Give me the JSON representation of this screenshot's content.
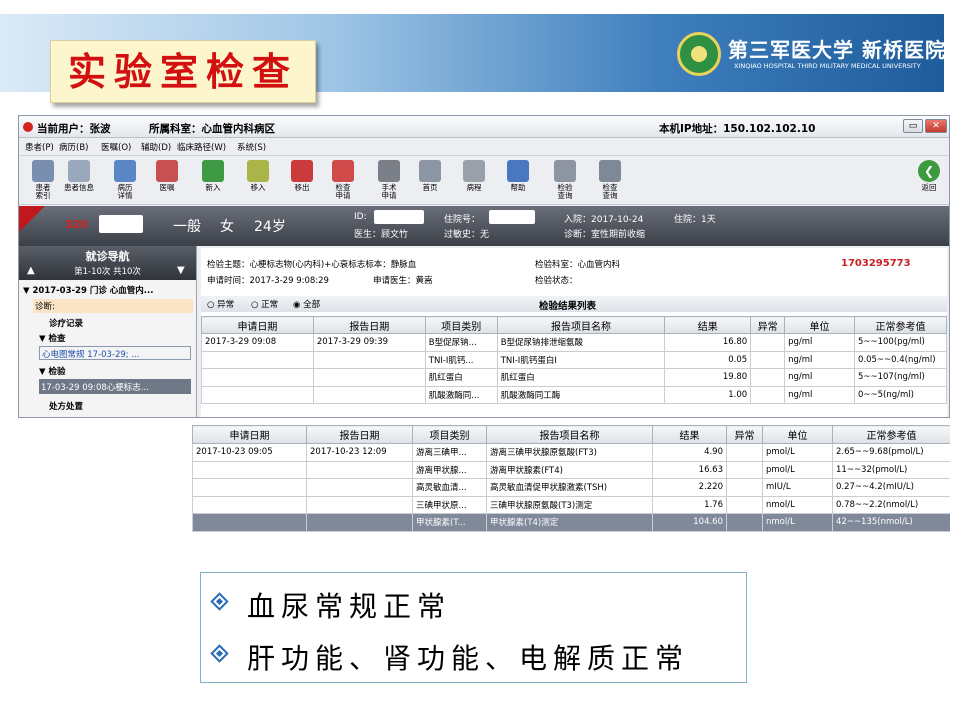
{
  "slide": {
    "title": "实验室检查",
    "hospital_name": "第三军医大学 新桥医院",
    "hospital_sub": "XINQIAO HOSPITAL THIRD MILITARY MEDICAL UNIVERSITY"
  },
  "app": {
    "current_user": "当前用户：张波",
    "department": "所属科室：心血管内科病区",
    "ip": "本机IP地址：150.102.102.10",
    "menu": [
      "患者(P)",
      "病历(B)",
      "医嘱(O)",
      "辅助(D)",
      "临床路径(W)",
      "系统(S)"
    ],
    "toolbar": [
      {
        "label": "患者\n索引",
        "icon": "people-icon",
        "color": "#7a8fb0"
      },
      {
        "label": "患者信息",
        "icon": "patient-card-icon",
        "color": "#9aa8bb"
      },
      {
        "label": "病历\n详情",
        "icon": "record-icon",
        "color": "#5b86c5"
      },
      {
        "label": "医嘱",
        "icon": "order-icon",
        "color": "#c85050"
      },
      {
        "label": "新入",
        "icon": "arrow-in-icon",
        "color": "#3e9a44"
      },
      {
        "label": "移入",
        "icon": "move-in-icon",
        "color": "#a9b546"
      },
      {
        "label": "移出",
        "icon": "move-out-icon",
        "color": "#cc3b3b"
      },
      {
        "label": "检查\n申请",
        "icon": "exam-request-icon",
        "color": "#d04a4a"
      },
      {
        "label": "手术\n申请",
        "icon": "surgery-icon",
        "color": "#7a7f88"
      },
      {
        "label": "首页",
        "icon": "home-page-icon",
        "color": "#8b95a3"
      },
      {
        "label": "病程",
        "icon": "progress-note-icon",
        "color": "#9aa0aa"
      },
      {
        "label": "帮助",
        "icon": "help-icon",
        "color": "#4a78c0"
      },
      {
        "label": "检验\n查询",
        "icon": "lab-query-icon",
        "color": "#8d95a3"
      },
      {
        "label": "检查\n查询",
        "icon": "exam-query-icon",
        "color": "#7e8896"
      }
    ],
    "back_label": "返回",
    "patient": {
      "bed": "320",
      "grade": "一般",
      "sex": "女",
      "age": "24岁",
      "id_label": "ID:",
      "doctor": "医生：顾文竹",
      "admit_label": "住院号：",
      "allergy": "过敏史：无",
      "admit_date": "入院：2017-10-24",
      "days": "住院：1天",
      "diagnosis": "诊断：室性期前收缩"
    }
  },
  "sidebar": {
    "title": "就诊导航",
    "range": "第1-10次 共10次",
    "visit": "▼ 2017-03-29 门诊 心血管内...",
    "diag": "诊断:",
    "record": "诊疗记录",
    "check": "▼ 检查",
    "check_item": "心电图常规 17-03-29; ...",
    "lab": "▼ 检验",
    "lab_item": "17-03-29 09:08心梗标志...",
    "treat": "处方处置"
  },
  "lab": {
    "subject": "检验主题：心梗标志物(心内科)+心衰标志标本：静脉血",
    "dept": "检验科室：心血管内科",
    "request_time": "申请时间：2017-3-29 9:08:29",
    "doctor": "申请医生：黄嵩",
    "status": "检验状态：",
    "code": "1703295773",
    "filters": [
      "异常",
      "正常",
      "全部"
    ],
    "list_title": "检验结果列表",
    "headers": [
      "申请日期",
      "报告日期",
      "项目类别",
      "报告项目名称",
      "结果",
      "异常",
      "单位",
      "正常参考值"
    ],
    "rows": [
      [
        "2017-3-29 09:08",
        "2017-3-29 09:39",
        "B型促尿钠...",
        "B型促尿钠排泄缩氨酸",
        "16.80",
        "",
        "pg/ml",
        "5~~100(pg/ml)"
      ],
      [
        "",
        "",
        "TNI-I肌钙...",
        "TNI-I肌钙蛋白I",
        "0.05",
        "",
        "ng/ml",
        "0.05~~0.4(ng/ml)"
      ],
      [
        "",
        "",
        "肌红蛋白",
        "肌红蛋白",
        "19.80",
        "",
        "ng/ml",
        "5~~107(ng/ml)"
      ],
      [
        "",
        "",
        "肌酸激酶同...",
        "肌酸激酶同工酶",
        "1.00",
        "",
        "ng/ml",
        "0~~5(ng/ml)"
      ]
    ]
  },
  "lab2": {
    "headers": [
      "申请日期",
      "报告日期",
      "项目类别",
      "报告项目名称",
      "结果",
      "异常",
      "单位",
      "正常参考值"
    ],
    "rows": [
      [
        "2017-10-23 09:05",
        "2017-10-23 12:09",
        "游离三碘甲...",
        "游离三碘甲状腺原氨酸(FT3)",
        "4.90",
        "",
        "pmol/L",
        "2.65~~9.68(pmol/L)"
      ],
      [
        "",
        "",
        "游离甲状腺...",
        "游离甲状腺素(FT4)",
        "16.63",
        "",
        "pmol/L",
        "11~~32(pmol/L)"
      ],
      [
        "",
        "",
        "高灵敏血清...",
        "高灵敏血清促甲状腺激素(TSH)",
        "2.220",
        "",
        "mIU/L",
        "0.27~~4.2(mIU/L)"
      ],
      [
        "",
        "",
        "三碘甲状原...",
        "三碘甲状腺原氨酸(T3)测定",
        "1.76",
        "",
        "nmol/L",
        "0.78~~2.2(nmol/L)"
      ],
      [
        "",
        "",
        "甲状腺素(T...",
        "甲状腺素(T4)测定",
        "104.60",
        "",
        "nmol/L",
        "42~~135(nmol/L)"
      ]
    ]
  },
  "summary": [
    "血尿常规正常",
    "肝功能、肾功能、电解质正常"
  ]
}
